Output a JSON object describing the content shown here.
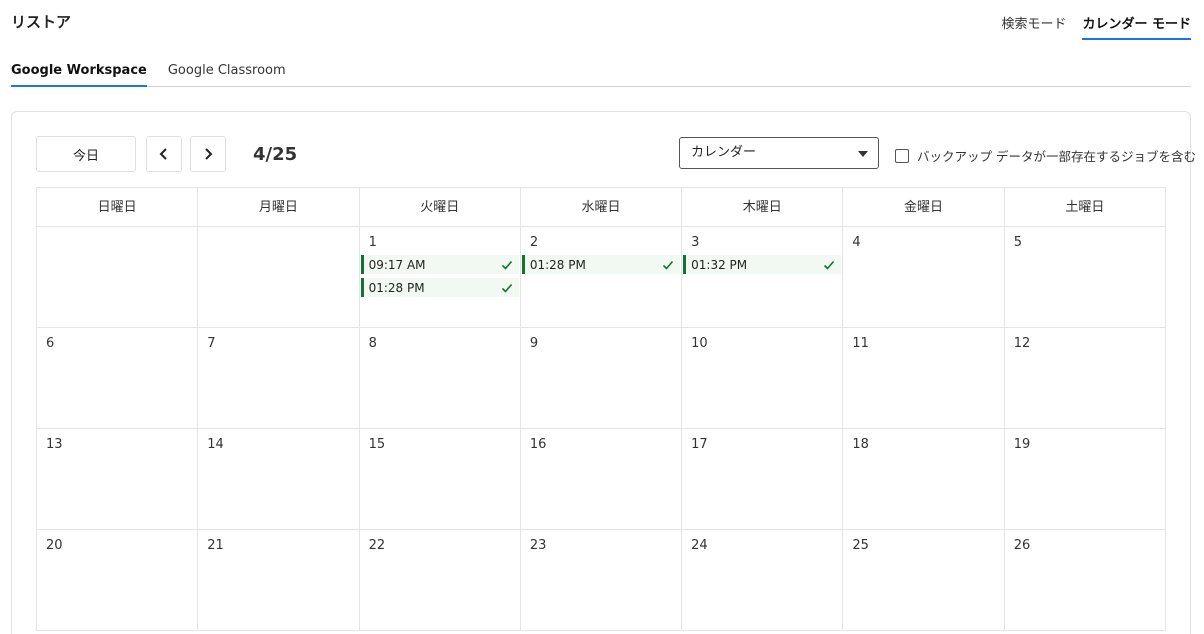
{
  "header": {
    "title": "リストア",
    "modes": [
      {
        "label": "検索モード",
        "active": false
      },
      {
        "label": "カレンダー モード",
        "active": true
      }
    ]
  },
  "tabs": [
    {
      "label": "Google Workspace",
      "active": true
    },
    {
      "label": "Google Classroom",
      "active": false
    }
  ],
  "toolbar": {
    "today_label": "今日",
    "prev_icon": "chevron-left-icon",
    "next_icon": "chevron-right-icon",
    "current_month": "4/25",
    "view_select_value": "カレンダー",
    "partial_backup_label": "バックアップ データが一部存在するジョブを含む",
    "partial_backup_checked": false
  },
  "colors": {
    "accent": "#1a73e8",
    "success": "#137333",
    "job_bg": "#f2f8f2"
  },
  "calendar": {
    "weekdays": [
      "日曜日",
      "月曜日",
      "火曜日",
      "水曜日",
      "木曜日",
      "金曜日",
      "土曜日"
    ],
    "weeks": [
      [
        {
          "day": "",
          "jobs": []
        },
        {
          "day": "",
          "jobs": []
        },
        {
          "day": "1",
          "jobs": [
            {
              "time": "09:17 AM",
              "status": "success"
            },
            {
              "time": "01:28 PM",
              "status": "success"
            }
          ]
        },
        {
          "day": "2",
          "jobs": [
            {
              "time": "01:28 PM",
              "status": "success"
            }
          ]
        },
        {
          "day": "3",
          "jobs": [
            {
              "time": "01:32 PM",
              "status": "success"
            }
          ]
        },
        {
          "day": "4",
          "jobs": []
        },
        {
          "day": "5",
          "jobs": []
        }
      ],
      [
        {
          "day": "6",
          "jobs": []
        },
        {
          "day": "7",
          "jobs": []
        },
        {
          "day": "8",
          "jobs": []
        },
        {
          "day": "9",
          "jobs": []
        },
        {
          "day": "10",
          "jobs": []
        },
        {
          "day": "11",
          "jobs": []
        },
        {
          "day": "12",
          "jobs": []
        }
      ],
      [
        {
          "day": "13",
          "jobs": []
        },
        {
          "day": "14",
          "jobs": []
        },
        {
          "day": "15",
          "jobs": []
        },
        {
          "day": "16",
          "jobs": []
        },
        {
          "day": "17",
          "jobs": []
        },
        {
          "day": "18",
          "jobs": []
        },
        {
          "day": "19",
          "jobs": []
        }
      ],
      [
        {
          "day": "20",
          "jobs": []
        },
        {
          "day": "21",
          "jobs": []
        },
        {
          "day": "22",
          "jobs": []
        },
        {
          "day": "23",
          "jobs": []
        },
        {
          "day": "24",
          "jobs": []
        },
        {
          "day": "25",
          "jobs": []
        },
        {
          "day": "26",
          "jobs": []
        }
      ]
    ]
  }
}
